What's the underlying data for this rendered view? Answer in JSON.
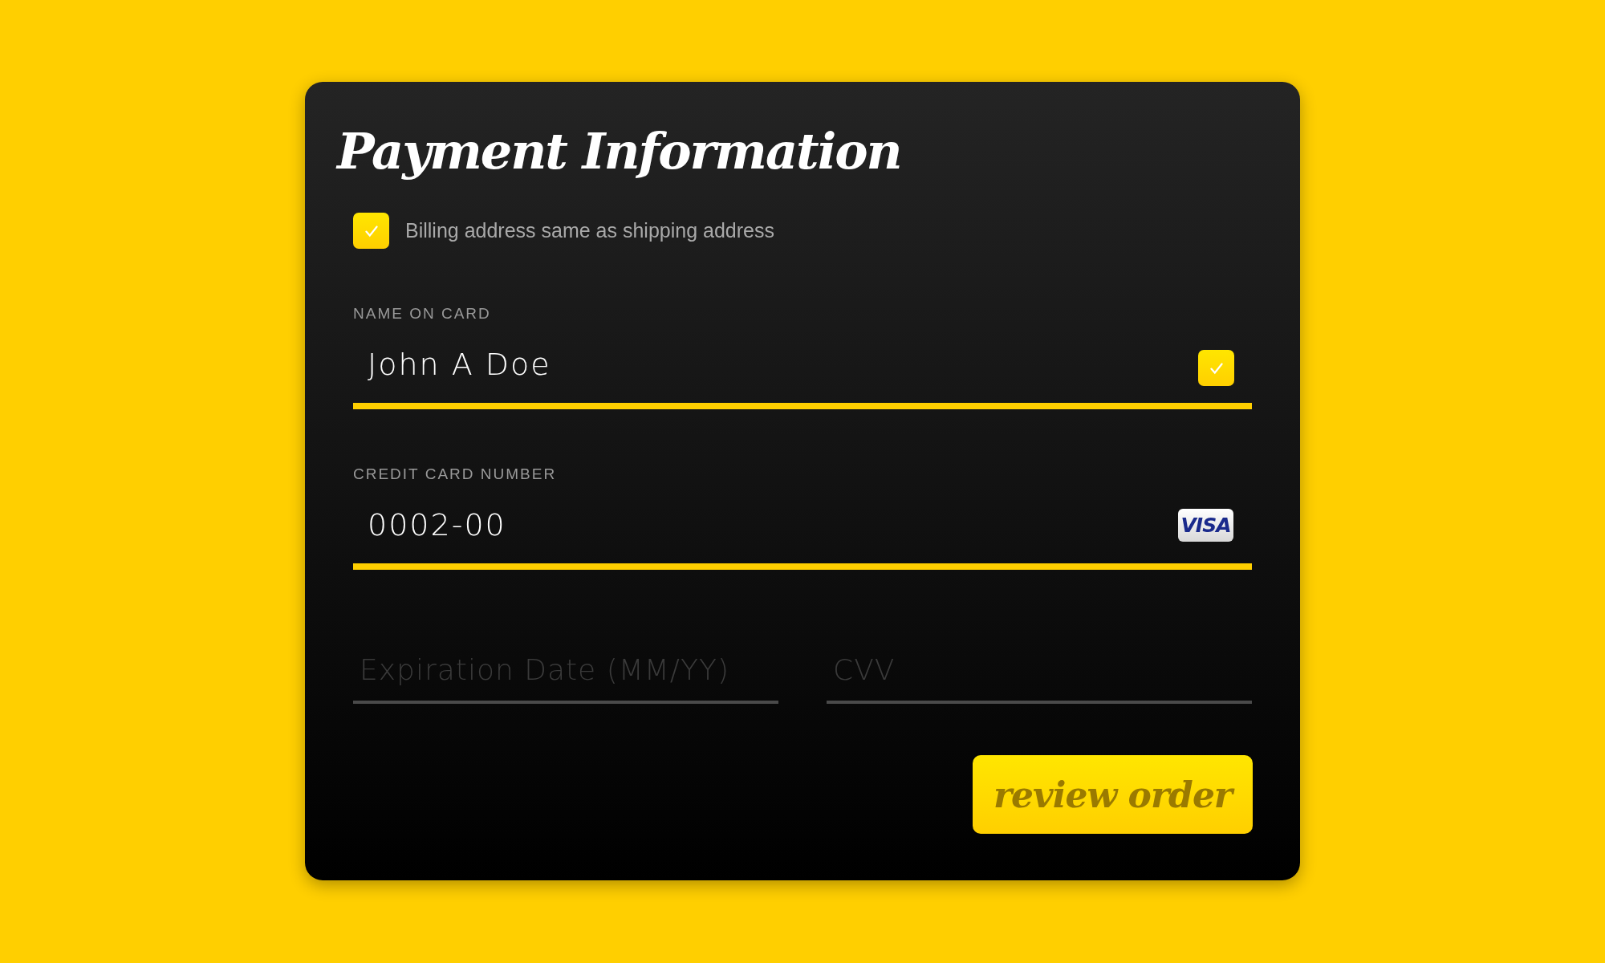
{
  "title": "Payment Information",
  "billing_same": {
    "label": "Billing address same as shipping address",
    "checked": true
  },
  "fields": [
    {
      "kind": "full",
      "label": "NAME ON CARD",
      "value": "John A Doe",
      "valid": true
    },
    {
      "kind": "full",
      "label": "CREDIT CARD NUMBER",
      "value": "0002-00",
      "card_brand": "VISA"
    }
  ],
  "half_fields": [
    {
      "placeholder": "Expiration Date (MM/YY)"
    },
    {
      "placeholder": "CVV"
    }
  ],
  "button": {
    "label": "review order"
  }
}
